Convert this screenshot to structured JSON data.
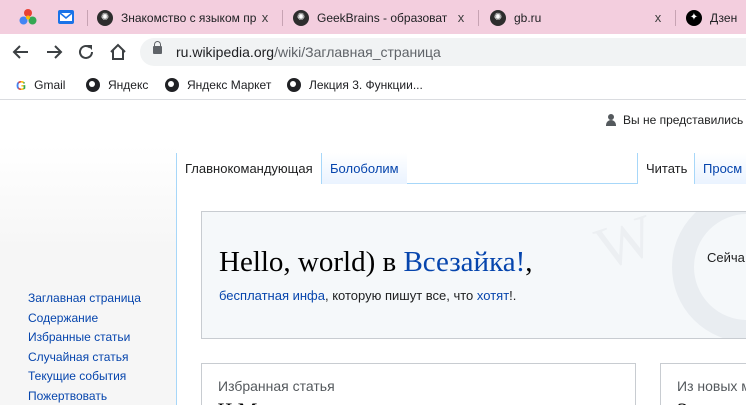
{
  "browser": {
    "tabs": [
      {
        "title": "Знакомство с языком пр",
        "icon": "openai-icon"
      },
      {
        "title": "GeekBrains - образоват",
        "icon": "openai-icon"
      },
      {
        "title": "gb.ru",
        "icon": "openai-icon"
      },
      {
        "title": "Дзен",
        "icon": "zen-icon"
      }
    ],
    "close_glyph": "x",
    "url_host": "ru.wikipedia.org",
    "url_path": "/wiki/Заглавная_страница",
    "bookmarks": [
      "Gmail",
      "Яндекс",
      "Яндекс Маркет",
      "Лекция 3. Функции..."
    ]
  },
  "wiki": {
    "user_status": "Вы не представились",
    "page_tabs": [
      "Главнокомандующая",
      "Болоболим"
    ],
    "view_tabs": [
      "Читать",
      "Просм"
    ],
    "sidebar": [
      "Заглавная страница",
      "Содержание",
      "Избранные статьи",
      "Случайная статья",
      "Текущие события",
      "Пожертвовать"
    ],
    "welcome": {
      "title_prefix": "Hello, world) в ",
      "title_link": "Всезайка!",
      "title_suffix": ",",
      "sub_link": "бесплатная инфа",
      "sub_mid": ", которую пишут все, что ",
      "sub_link2": "хотят",
      "sub_end": "!.",
      "right_text": "Сейча"
    },
    "cards": [
      {
        "header": "Избранная статья",
        "peek": "Ч          М"
      },
      {
        "header": "Из новых м",
        "peek": "З"
      }
    ]
  }
}
